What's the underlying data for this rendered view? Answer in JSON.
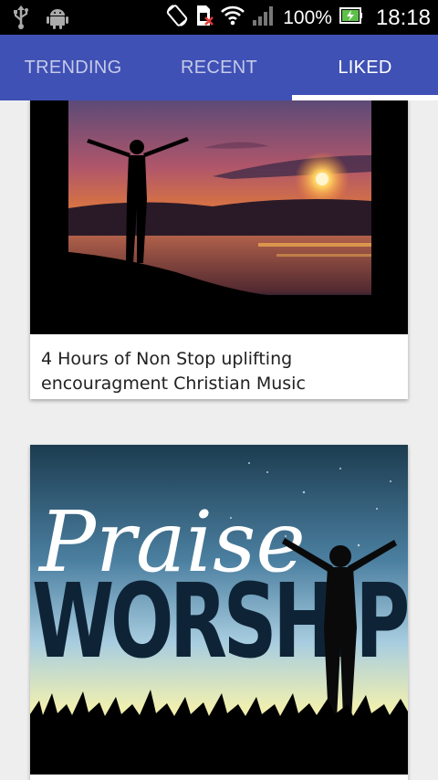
{
  "status_bar": {
    "left_icons": [
      "usb-icon",
      "android-icon"
    ],
    "right_icons": [
      "rotate-icon",
      "sim-icon",
      "wifi-icon",
      "signal-icon",
      "battery-charging-icon"
    ],
    "battery": "100%",
    "time": "18:18"
  },
  "tabs": [
    {
      "label": "TRENDING",
      "active": false
    },
    {
      "label": "RECENT",
      "active": false
    },
    {
      "label": "LIKED",
      "active": true
    }
  ],
  "colors": {
    "app_bar": "#3f51b5",
    "tab_inactive_text": "#c5cae9",
    "tab_active_text": "#ffffff",
    "background": "#eeeeee",
    "card": "#ffffff"
  },
  "videos": [
    {
      "title": "4 Hours of Non Stop uplifting encouragment Christian Music",
      "thumbnail": "sunset-silhouette-arms-raised"
    },
    {
      "title": "",
      "thumbnail": "praise-worship-graphic",
      "thumbnail_text": [
        "Praise",
        "WORSHIP"
      ]
    }
  ]
}
